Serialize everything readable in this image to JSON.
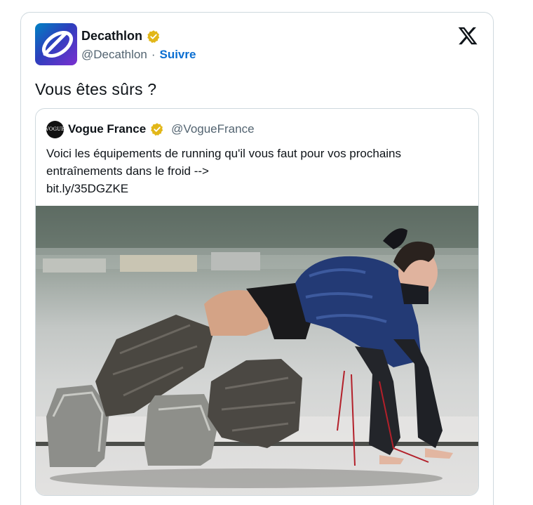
{
  "tweet": {
    "author": {
      "name": "Decathlon",
      "handle": "@Decathlon",
      "separator": "·",
      "follow_label": "Suivre"
    },
    "text": "Vous êtes sûrs ?",
    "quoted": {
      "author": {
        "name": "Vogue France",
        "handle": "@VogueFrance",
        "avatar_text": "VOGUE"
      },
      "text_lines": [
        "Voici les équipements de running qu'il vous faut pour vos prochains",
        "entraînements dans le froid -->",
        "bit.ly/35DGZKE"
      ],
      "media": {
        "type": "photo"
      }
    }
  },
  "colors": {
    "link": "#0a6ed1",
    "verified_gold": "#e2b719",
    "border": "#cfd9de",
    "secondary_text": "#536471"
  },
  "icons": {
    "x_logo": "x-logo-icon",
    "verified": "verified-badge-icon"
  }
}
